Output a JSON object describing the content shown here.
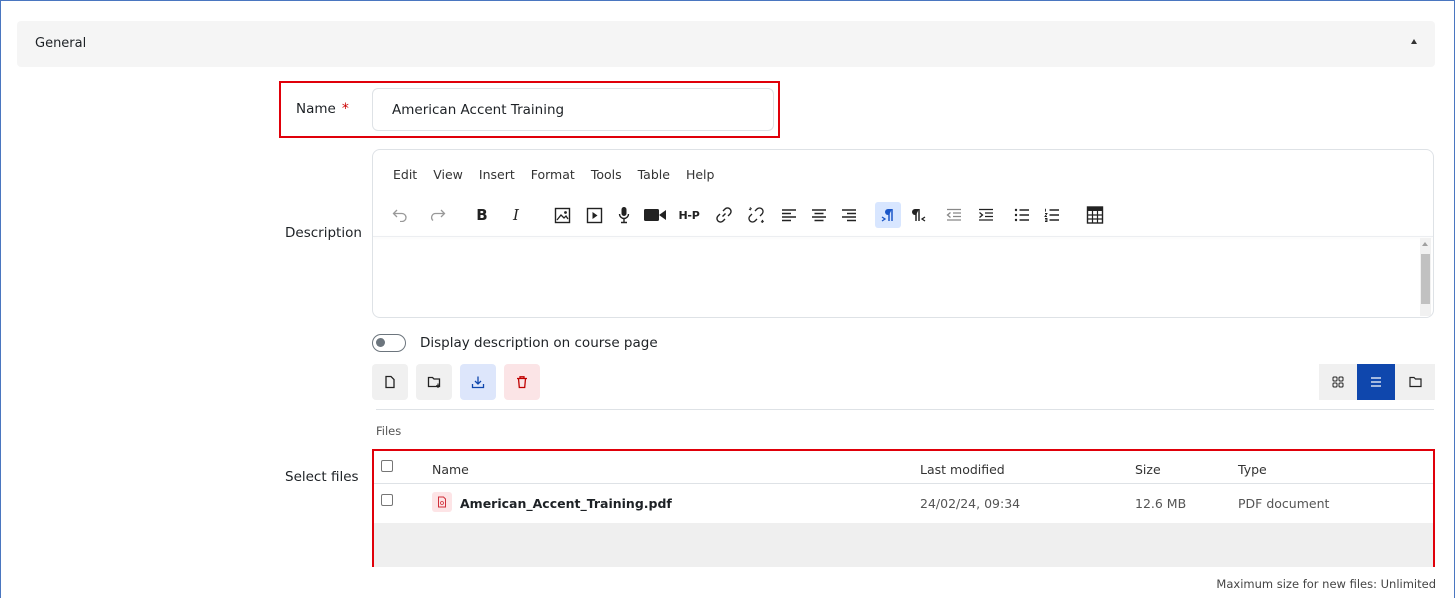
{
  "section": {
    "title": "General"
  },
  "name_field": {
    "label": "Name",
    "required_mark": "*",
    "value": "American Accent Training"
  },
  "description": {
    "label": "Description",
    "menu": [
      "Edit",
      "View",
      "Insert",
      "Format",
      "Tools",
      "Table",
      "Help"
    ],
    "toolbar_icons": [
      "undo-icon",
      "redo-icon",
      "bold-icon",
      "italic-icon",
      "image-icon",
      "media-icon",
      "record-audio-icon",
      "record-video-icon",
      "h5p-icon",
      "link-icon",
      "unlink-icon",
      "align-left-icon",
      "align-center-icon",
      "align-right-icon",
      "ltr-icon",
      "rtl-icon",
      "outdent-icon",
      "indent-icon",
      "bullet-list-icon",
      "numbered-list-icon",
      "calculator-icon"
    ],
    "bold_glyph": "B",
    "italic_glyph": "I",
    "h5p_glyph": "H-P"
  },
  "display_toggle": {
    "label": "Display description on course page",
    "checked": false
  },
  "select_files": {
    "label": "Select files",
    "caption": "Files",
    "columns": {
      "name": "Name",
      "modified": "Last modified",
      "size": "Size",
      "type": "Type"
    },
    "files": [
      {
        "name": "American_Accent_Training.pdf",
        "modified": "24/02/24, 09:34",
        "size": "12.6 MB",
        "type": "PDF document"
      }
    ],
    "max_size_note": "Maximum size for new files: Unlimited"
  },
  "colors": {
    "accent": "#0f47ad",
    "required": "#c00000",
    "highlight_border": "#e0000a"
  }
}
